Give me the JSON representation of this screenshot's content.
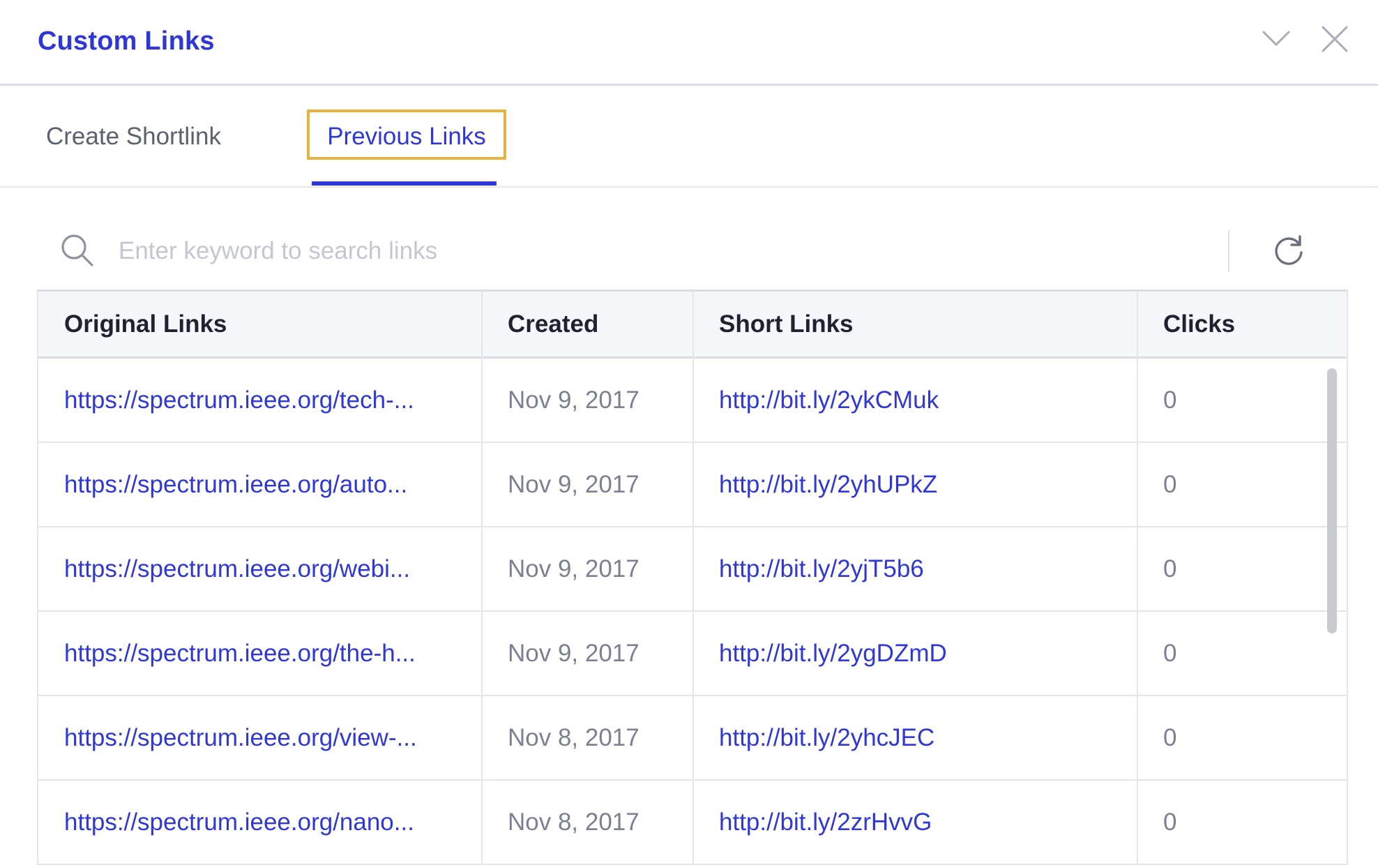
{
  "panel": {
    "title": "Custom Links",
    "header_icons": {
      "collapse": "chevron-down-icon",
      "close": "close-icon"
    }
  },
  "tabs": [
    {
      "label": "Create Shortlink",
      "active": false
    },
    {
      "label": "Previous Links",
      "active": true
    }
  ],
  "search": {
    "placeholder": "Enter keyword to search links",
    "value": "",
    "icon": "search-icon",
    "refresh_icon": "refresh-icon"
  },
  "table": {
    "columns": [
      "Original Links",
      "Created",
      "Short Links",
      "Clicks"
    ],
    "rows": [
      {
        "original": "https://spectrum.ieee.org/tech-...",
        "created": "Nov 9, 2017",
        "short": "http://bit.ly/2ykCMuk",
        "clicks": "0"
      },
      {
        "original": "https://spectrum.ieee.org/auto...",
        "created": "Nov 9, 2017",
        "short": "http://bit.ly/2yhUPkZ",
        "clicks": "0"
      },
      {
        "original": "https://spectrum.ieee.org/webi...",
        "created": "Nov 9, 2017",
        "short": "http://bit.ly/2yjT5b6",
        "clicks": "0"
      },
      {
        "original": "https://spectrum.ieee.org/the-h...",
        "created": "Nov 9, 2017",
        "short": "http://bit.ly/2ygDZmD",
        "clicks": "0"
      },
      {
        "original": "https://spectrum.ieee.org/view-...",
        "created": "Nov 8, 2017",
        "short": "http://bit.ly/2yhcJEC",
        "clicks": "0"
      },
      {
        "original": "https://spectrum.ieee.org/nano...",
        "created": "Nov 8, 2017",
        "short": "http://bit.ly/2zrHvvG",
        "clicks": "0"
      }
    ]
  },
  "colors": {
    "accent": "#2f38d6",
    "focus_outline": "#e8b33c",
    "header_bg": "#f6f7fb",
    "muted_text": "#7c8090"
  }
}
